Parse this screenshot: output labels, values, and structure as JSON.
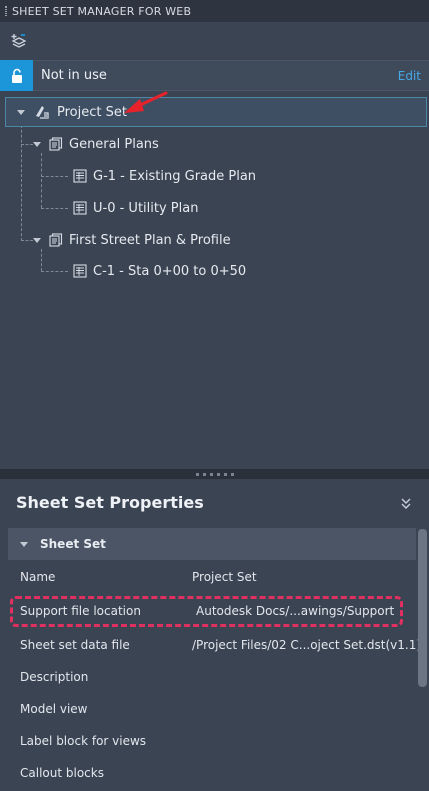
{
  "title": "SHEET SET MANAGER FOR WEB",
  "toolbar": {
    "add_icon": "new-sheet-set-icon"
  },
  "lock": {
    "icon": "unlock-icon",
    "status": "Not in use",
    "edit_label": "Edit"
  },
  "tree": {
    "root": {
      "label": "Project Set",
      "icon": "sheet-set-icon"
    },
    "subsets": [
      {
        "label": "General Plans",
        "sheets": [
          "G-1 - Existing Grade Plan",
          "U-0 - Utility Plan"
        ]
      },
      {
        "label": "First Street Plan & Profile",
        "sheets": [
          "C-1 - Sta 0+00 to 0+50"
        ]
      }
    ]
  },
  "properties": {
    "title": "Sheet Set Properties",
    "section": "Sheet Set",
    "rows": [
      {
        "name": "Name",
        "value": "Project Set"
      },
      {
        "name": "Support file location",
        "value": "Autodesk Docs/...awings/Support"
      },
      {
        "name": "Sheet set data file",
        "value": "/Project Files/02 C...oject Set.dst(v1.1)"
      },
      {
        "name": "Description",
        "value": ""
      },
      {
        "name": "Model view",
        "value": ""
      },
      {
        "name": "Label block for views",
        "value": ""
      },
      {
        "name": "Callout blocks",
        "value": ""
      }
    ]
  },
  "colors": {
    "accent": "#1c95d9",
    "highlight": "#e0305f",
    "arrow": "#e8222b"
  }
}
